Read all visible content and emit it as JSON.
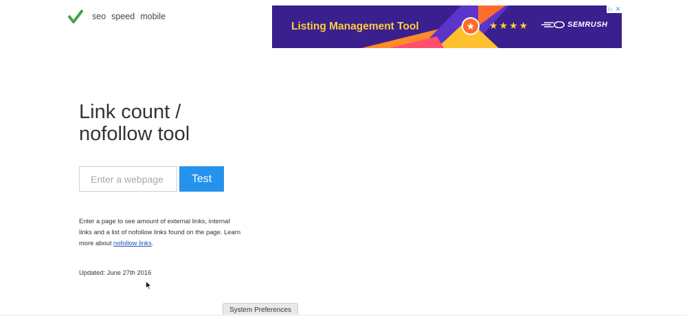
{
  "header": {
    "logo_icon": "checkmark-logo-icon",
    "nav": [
      "seo",
      "speed",
      "mobile"
    ]
  },
  "ad": {
    "title": "Listing Management Tool",
    "badge_icon": "star-badge-icon",
    "stars": "★★★★",
    "brand": "SEMRUSH",
    "info_icon": "ad-info-icon",
    "close_icon": "close-icon",
    "colors": {
      "background": "#3a1f8e",
      "title": "#ffcf3a",
      "accent": "#ff6b2b"
    }
  },
  "main": {
    "title_line1": "Link count /",
    "title_line2": "nofollow tool",
    "input_placeholder": "Enter a webpage",
    "test_label": "Test",
    "description": "Enter a page to see amount of external links, internal links and a list of nofollow links found on the page. Learn more about ",
    "description_link": "nofollow links",
    "description_end": ".",
    "updated": "Updated: June 27th 2016",
    "colors": {
      "button": "#2593ec",
      "link": "#1a55b6"
    }
  },
  "dock": {
    "tooltip": "System Preferences"
  }
}
